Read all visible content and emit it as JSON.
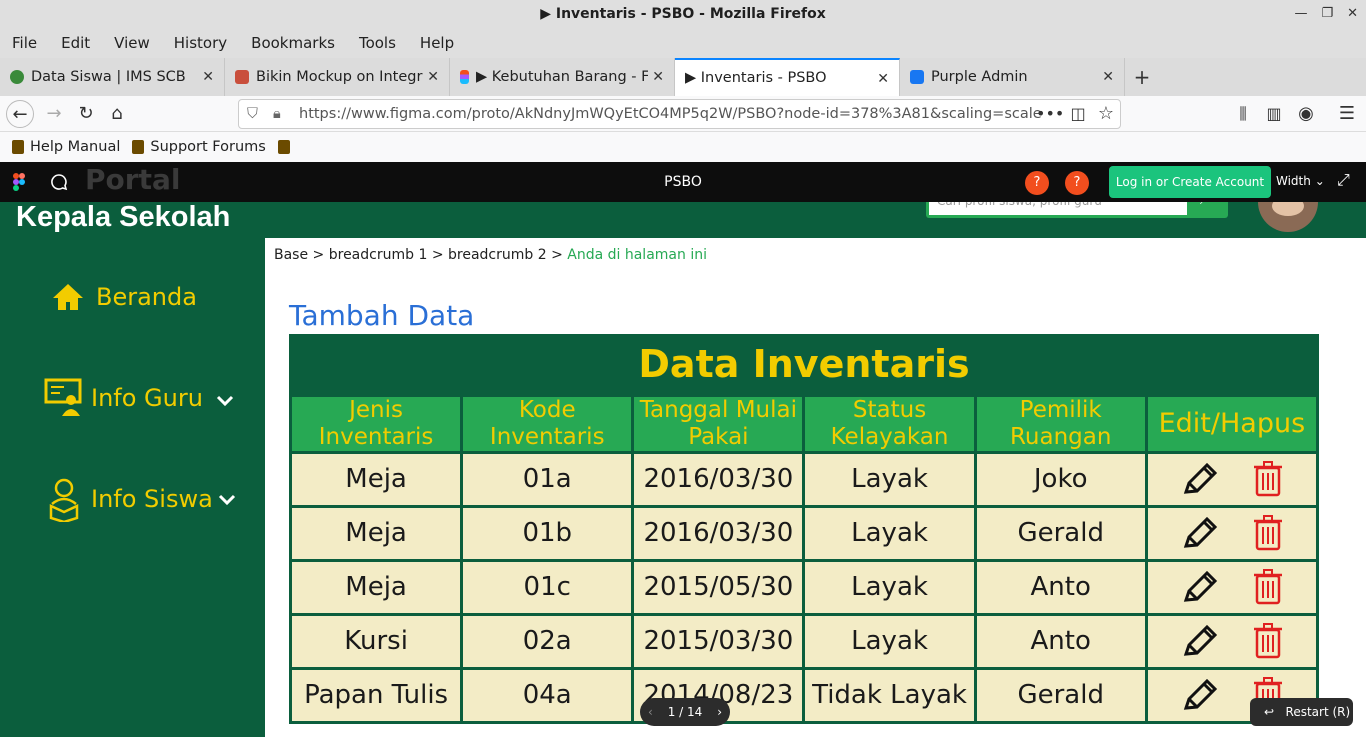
{
  "window": {
    "title": "▶ Inventaris - PSBO - Mozilla Firefox"
  },
  "menu": [
    "File",
    "Edit",
    "View",
    "History",
    "Bookmarks",
    "Tools",
    "Help"
  ],
  "tabs": [
    {
      "label": "Data Siswa | IMS SCB",
      "color": "#3a8a3a"
    },
    {
      "label": "Bikin Mockup on Integr",
      "color": "#c94f3c"
    },
    {
      "label": "▶ Kebutuhan Barang - F",
      "color": "#a259ff"
    },
    {
      "label": "▶ Inventaris - PSBO",
      "color": "#f24e1e"
    },
    {
      "label": "Purple Admin",
      "color": "#1877f2"
    }
  ],
  "url": "https://www.figma.com/proto/AkNdnyJmWQyEtCO4MP5q2W/PSBO?node-id=378%3A81&scaling=scale",
  "bookmarks": [
    "Help Manual",
    "Support Forums"
  ],
  "figma": {
    "portal": "Portal",
    "file_name": "PSBO",
    "badge": "?",
    "login_label": "Log in or Create Account",
    "width_label": "Width",
    "page_indicator": "1 / 14",
    "restart_label": "Restart (R)"
  },
  "app": {
    "role_title": "Kepala Sekolah",
    "search_placeholder": "Cari profil siswa, profil guru",
    "breadcrumb": {
      "base": "Base",
      "b1": "breadcrumb 1",
      "b2": "breadcrumb 2",
      "current": "Anda di halaman ini",
      "sep": ">"
    },
    "sidebar": [
      {
        "label": "Beranda",
        "icon": "home-icon"
      },
      {
        "label": "Info Guru",
        "icon": "teacher-icon"
      },
      {
        "label": "Info Siswa",
        "icon": "student-icon"
      }
    ],
    "add_data_label": "Tambah Data",
    "table": {
      "title": "Data Inventaris",
      "headers": [
        "Jenis Inventaris",
        "Kode Inventaris",
        "Tanggal Mulai Pakai",
        "Status Kelayakan",
        "Pemilik Ruangan",
        "Edit/Hapus"
      ],
      "rows": [
        [
          "Meja",
          "01a",
          "2016/03/30",
          "Layak",
          "Joko"
        ],
        [
          "Meja",
          "01b",
          "2016/03/30",
          "Layak",
          "Gerald"
        ],
        [
          "Meja",
          "01c",
          "2015/05/30",
          "Layak",
          "Anto"
        ],
        [
          "Kursi",
          "02a",
          "2015/03/30",
          "Layak",
          "Anto"
        ],
        [
          "Papan Tulis",
          "04a",
          "2014/08/23",
          "Tidak Layak",
          "Gerald"
        ]
      ]
    }
  },
  "colors": {
    "primary_green": "#0b5e3d",
    "header_green": "#27a954",
    "accent_yellow": "#f2cc00",
    "cell_bg": "#f3ecc6",
    "link_blue": "#2a6fd6",
    "delete_red": "#e02020",
    "login_green": "#1bc47d"
  }
}
